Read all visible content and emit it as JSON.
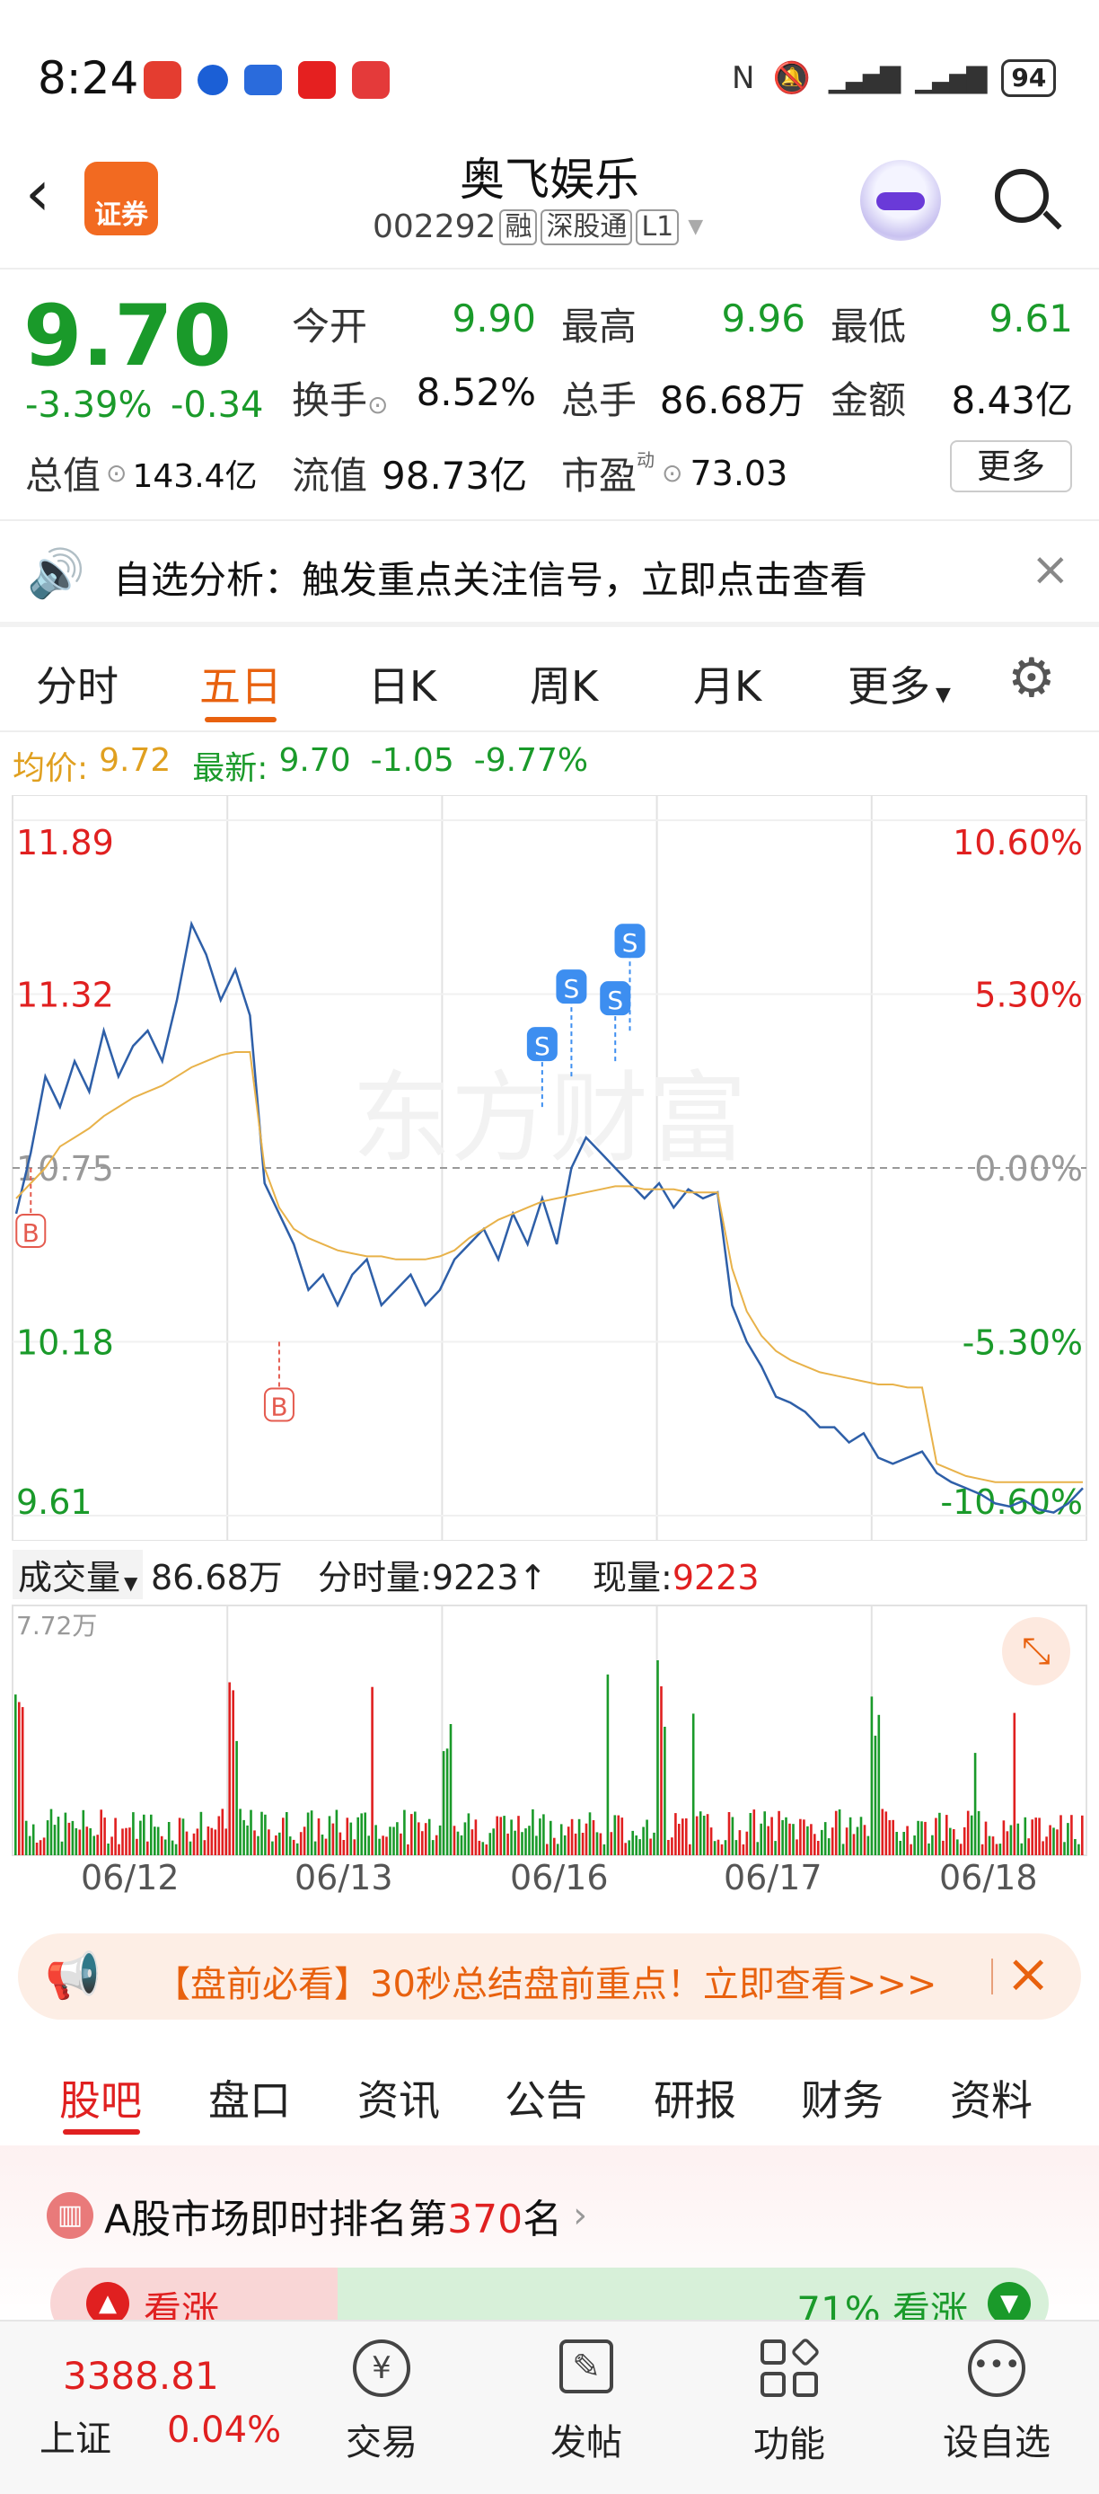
{
  "status_bar": {
    "time": "8:24",
    "battery": "94",
    "app_icons": [
      "app-icon-1",
      "app-icon-2",
      "app-icon-3",
      "app-icon-4",
      "app-icon-5"
    ]
  },
  "header": {
    "title": "奥飞娱乐",
    "code": "002292",
    "badges": [
      "融",
      "深股通",
      "L1"
    ],
    "broker_label": "证券"
  },
  "quote": {
    "price": "9.70",
    "change_pct": "-3.39%",
    "change_val": "-0.34",
    "stats": [
      {
        "label": "今开",
        "value": "9.90",
        "color": "green"
      },
      {
        "label": "最高",
        "value": "9.96",
        "color": "green"
      },
      {
        "label": "最低",
        "value": "9.61",
        "color": "green"
      },
      {
        "label": "换手",
        "value": "8.52%",
        "color": "black"
      },
      {
        "label": "总手",
        "value": "86.68万",
        "color": "black"
      },
      {
        "label": "金额",
        "value": "8.43亿",
        "color": "black"
      }
    ],
    "total_value_label": "总值",
    "total_value": "143.4亿",
    "float_label": "流值",
    "float_value": "98.73亿",
    "pe_label": "市盈",
    "pe_sup": "动",
    "pe_value": "73.03",
    "more_button": "更多"
  },
  "notice": {
    "text": "自选分析：触发重点关注信号，立即点击查看"
  },
  "tabs": {
    "items": [
      "分时",
      "五日",
      "日K",
      "周K",
      "月K",
      "更多"
    ],
    "active": 1
  },
  "info_line": {
    "avg_label": "均价:",
    "avg_value": "9.72",
    "latest_label": "最新:",
    "latest_value": "9.70",
    "change": "-1.05",
    "change_pct": "-9.77%"
  },
  "chart_data": {
    "type": "line",
    "title": "",
    "left_axis": [
      "11.89",
      "11.32",
      "10.75",
      "10.18",
      "9.61"
    ],
    "right_axis": [
      "10.60%",
      "5.30%",
      "0.00%",
      "-5.30%",
      "-10.60%"
    ],
    "ylim": [
      9.61,
      11.89
    ],
    "x_dates": [
      "06/12",
      "06/13",
      "06/16",
      "06/17",
      "06/18"
    ],
    "watermark": "东方财富",
    "series": [
      {
        "name": "",
        "values": [
          10.6,
          10.8,
          11.05,
          10.95,
          11.1,
          11.0,
          11.2,
          11.05,
          11.15,
          11.2,
          11.1,
          11.3,
          11.55,
          11.45,
          11.3,
          11.4,
          11.25,
          10.7,
          10.6,
          10.5,
          10.35,
          10.4,
          10.3,
          10.4,
          10.45,
          10.3,
          10.35,
          10.4,
          10.3,
          10.35,
          10.45,
          10.5,
          10.55,
          10.45,
          10.6,
          10.5,
          10.65,
          10.5,
          10.75,
          10.85,
          10.8,
          10.75,
          10.7,
          10.65,
          10.7,
          10.62,
          10.68,
          10.65,
          10.67,
          10.3,
          10.18,
          10.1,
          10.0,
          9.98,
          9.95,
          9.9,
          9.9,
          9.85,
          9.88,
          9.8,
          9.78,
          9.8,
          9.82,
          9.75,
          9.72,
          9.7,
          9.68,
          9.65,
          9.64,
          9.66,
          9.63,
          9.62,
          9.65,
          9.7
        ]
      },
      {
        "name": "",
        "values": [
          10.65,
          10.7,
          10.75,
          10.82,
          10.85,
          10.88,
          10.92,
          10.95,
          10.98,
          11.0,
          11.02,
          11.05,
          11.08,
          11.1,
          11.12,
          11.13,
          11.13,
          10.75,
          10.62,
          10.55,
          10.52,
          10.5,
          10.48,
          10.47,
          10.46,
          10.46,
          10.45,
          10.45,
          10.45,
          10.46,
          10.48,
          10.52,
          10.55,
          10.58,
          10.6,
          10.62,
          10.64,
          10.65,
          10.66,
          10.67,
          10.68,
          10.69,
          10.69,
          10.68,
          10.68,
          10.68,
          10.67,
          10.67,
          10.67,
          10.42,
          10.28,
          10.2,
          10.15,
          10.12,
          10.1,
          10.08,
          10.07,
          10.06,
          10.05,
          10.04,
          10.04,
          10.03,
          10.03,
          9.78,
          9.76,
          9.74,
          9.73,
          9.72,
          9.72,
          9.72,
          9.72,
          9.72,
          9.72,
          9.72
        ]
      }
    ],
    "markers": [
      {
        "label": "B",
        "x": 1,
        "y": 10.75,
        "color": "#e45b4f"
      },
      {
        "label": "B",
        "x": 18,
        "y": 10.18,
        "color": "#e45b4f"
      },
      {
        "label": "S",
        "x": 36,
        "y": 10.95,
        "color": "#3d8ef0"
      },
      {
        "label": "S",
        "x": 38,
        "y": 11.05,
        "color": "#3d8ef0"
      },
      {
        "label": "S",
        "x": 41,
        "y": 11.1,
        "color": "#3d8ef0"
      },
      {
        "label": "S",
        "x": 42,
        "y": 11.2,
        "color": "#3d8ef0"
      }
    ]
  },
  "volume": {
    "label": "成交量",
    "total": "86.68万",
    "minute_label": "分时量:",
    "minute_value": "9223↑",
    "now_label": "现量:",
    "now_value": "9223",
    "max_label": "7.72万"
  },
  "promo": {
    "text": "【盘前必看】30秒总结盘前重点！立即查看>>>"
  },
  "sub_tabs": {
    "items": [
      "股吧",
      "盘口",
      "资讯",
      "公告",
      "研报",
      "财务",
      "资料"
    ],
    "active": 0
  },
  "rank": {
    "prefix": "A股市场即时排名第",
    "rank": "370",
    "suffix": "名",
    "up_label": "看涨",
    "right_pct": "71%",
    "right_label": "看涨"
  },
  "bottom_nav": {
    "index_value": "3388.81",
    "index_name": "上证",
    "index_change": "0.04%",
    "items": [
      {
        "label": "交易",
        "icon": "yuan-icon"
      },
      {
        "label": "发帖",
        "icon": "edit-icon"
      },
      {
        "label": "功能",
        "icon": "grid-icon"
      },
      {
        "label": "设自选",
        "icon": "more-icon"
      }
    ]
  }
}
